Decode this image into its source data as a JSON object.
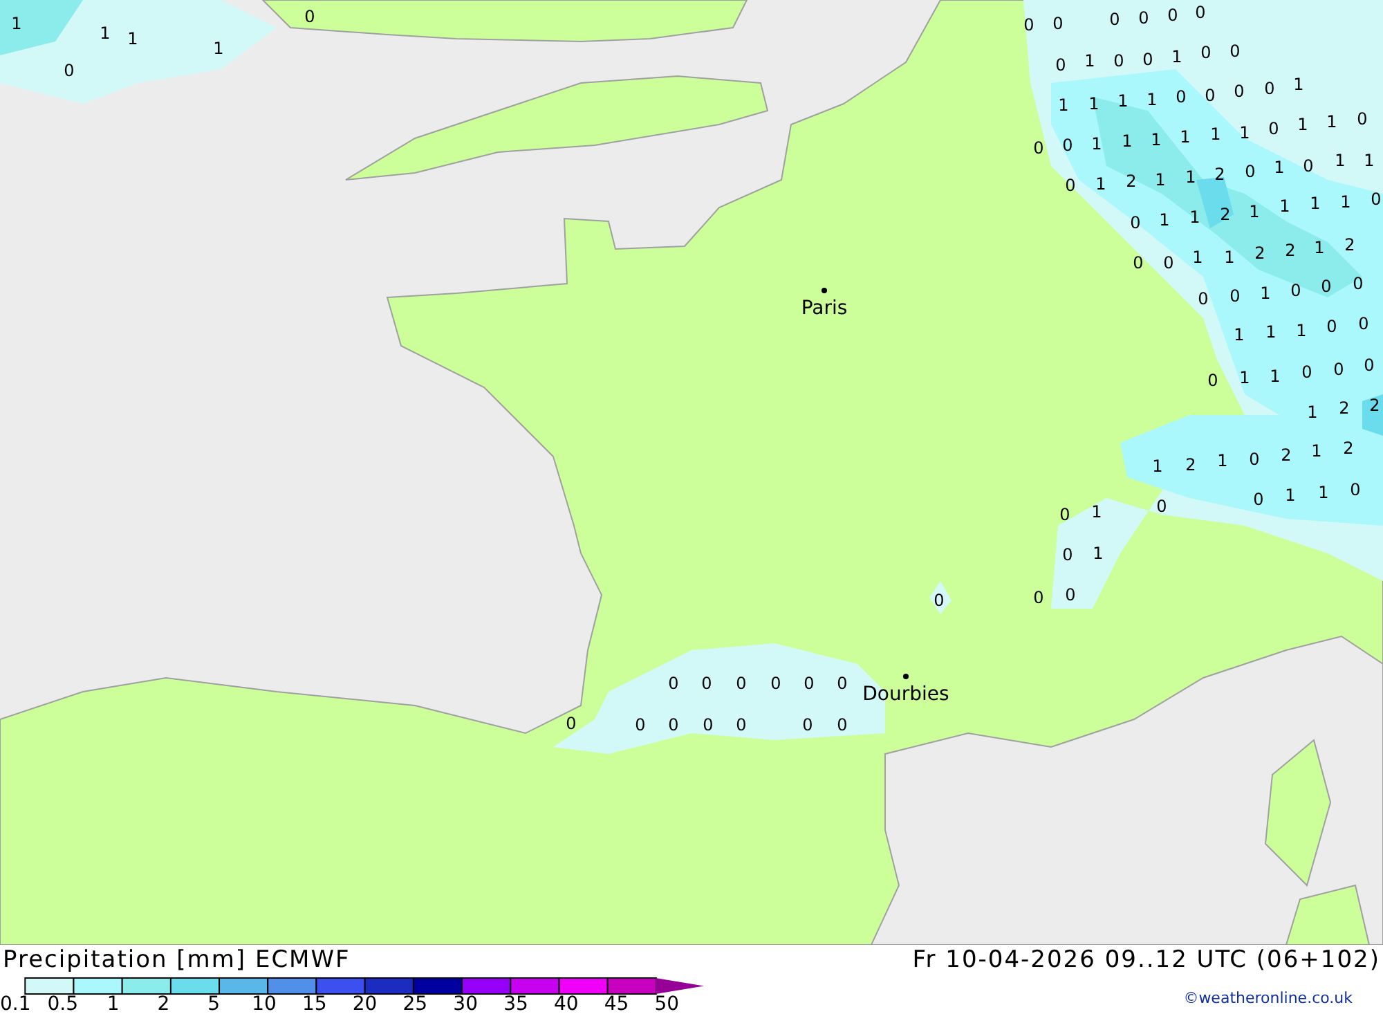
{
  "map": {
    "cities": [
      {
        "name": "Paris"
      },
      {
        "name": "Dourbies"
      }
    ],
    "value_labels": [
      "1",
      "1",
      "1",
      "0",
      "1",
      "0",
      "0",
      "0",
      "0",
      "0",
      "0",
      "0",
      "0",
      "1",
      "0",
      "0",
      "1",
      "0",
      "0",
      "1",
      "1",
      "1",
      "1",
      "0",
      "0",
      "0",
      "0",
      "1",
      "0",
      "0",
      "1",
      "1",
      "1",
      "1",
      "1",
      "1",
      "0",
      "1",
      "1",
      "0",
      "0",
      "1",
      "2",
      "1",
      "1",
      "2",
      "0",
      "1",
      "0",
      "1",
      "1",
      "0",
      "1",
      "1",
      "2",
      "1",
      "1",
      "1",
      "1",
      "0",
      "0",
      "0",
      "1",
      "1",
      "2",
      "2",
      "1",
      "2",
      "0",
      "0",
      "1",
      "0",
      "0",
      "0",
      "1",
      "1",
      "1",
      "0",
      "0",
      "0",
      "1",
      "1",
      "0",
      "0",
      "0",
      "1",
      "2",
      "2",
      "1",
      "2",
      "1",
      "0",
      "2",
      "1",
      "2",
      "0",
      "1",
      "1",
      "0",
      "0",
      "1",
      "0",
      "0",
      "1",
      "0",
      "0",
      "0",
      "0",
      "0",
      "0",
      "0",
      "0",
      "0",
      "0",
      "0",
      "0",
      "0",
      "0",
      "0",
      "0"
    ]
  },
  "legend": {
    "title": "Precipitation [mm] ECMWF",
    "bins": [
      {
        "color": "#d2f8f8"
      },
      {
        "color": "#aaf8fc"
      },
      {
        "color": "#8cecec"
      },
      {
        "color": "#6adcec"
      },
      {
        "color": "#5ab8e8"
      },
      {
        "color": "#5090e8"
      },
      {
        "color": "#3c50f0"
      },
      {
        "color": "#1c2cc0"
      },
      {
        "color": "#0000a0"
      },
      {
        "color": "#9600f8"
      },
      {
        "color": "#c800f0"
      },
      {
        "color": "#f000f8"
      },
      {
        "color": "#c800c0"
      }
    ],
    "ticks": [
      "0.1",
      "0.5",
      "1",
      "2",
      "5",
      "10",
      "15",
      "20",
      "25",
      "30",
      "35",
      "40",
      "45",
      "50"
    ]
  },
  "valid_time": "Fr 10-04-2026 09..12 UTC (06+102)",
  "credit": "©weatheronline.co.uk"
}
